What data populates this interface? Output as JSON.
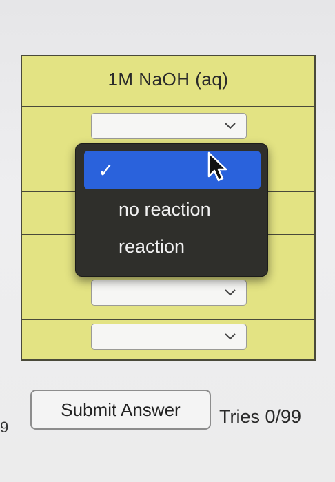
{
  "table": {
    "header": "1M NaOH (aq)",
    "row_count": 7
  },
  "dropdown_menu": {
    "selected_index": 0,
    "options": [
      "",
      "no reaction",
      "reaction"
    ],
    "check_glyph": "✓"
  },
  "actions": {
    "submit_label": "Submit Answer",
    "tries": "Tries 0/99"
  },
  "icons": {
    "dropdown": "chevron-down-icon",
    "check": "checkmark-icon",
    "cursor": "mouse-pointer-icon"
  },
  "colors": {
    "table_bg": "#e3e383",
    "menu_bg": "#2f2f2b",
    "selected_bg": "#2a62dc"
  }
}
